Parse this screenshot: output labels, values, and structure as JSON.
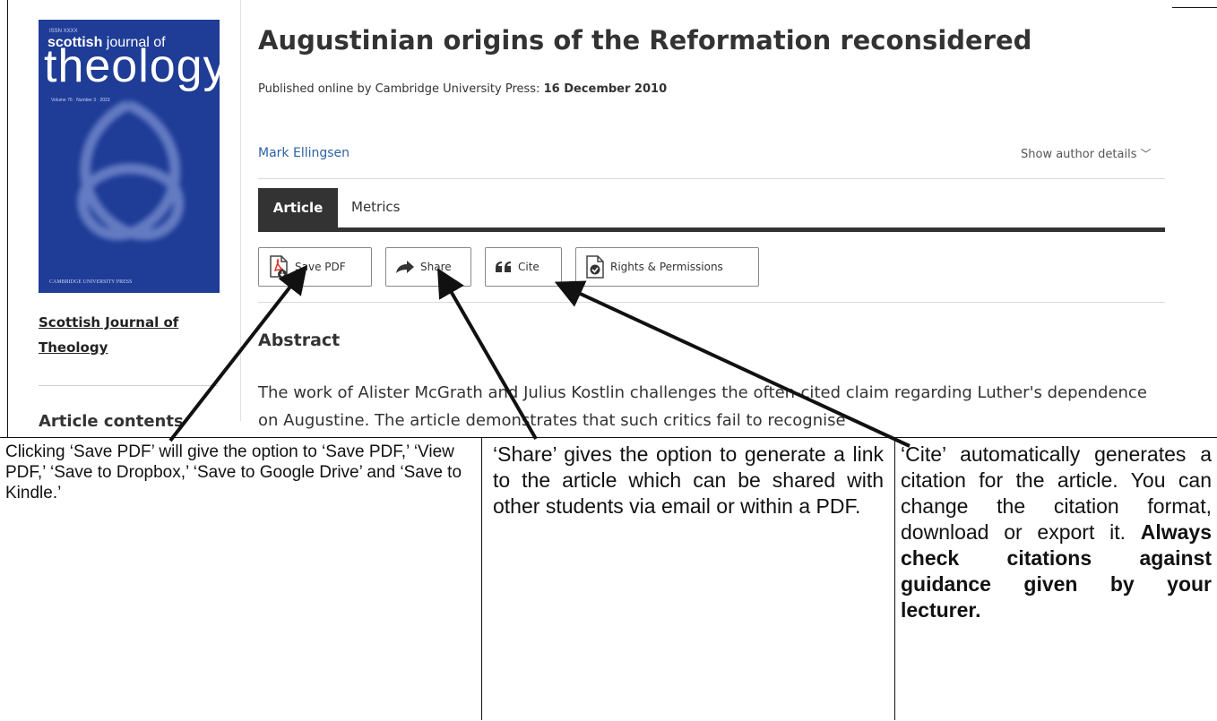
{
  "cover": {
    "issn_text": "ISSN XXXX",
    "journal_top": "scottish journal of",
    "journal_top_bold": "scottish",
    "journal_top_rest": " journal of",
    "journal_big": "theology",
    "volume_text": "Volume 76 · Number 3 · 2023",
    "publisher": "CAMBRIDGE UNIVERSITY PRESS"
  },
  "left": {
    "journal_link": "Scottish Journal of Theology",
    "contents_heading": "Article contents"
  },
  "article": {
    "title": "Augustinian origins of the Reformation reconsidered",
    "published_prefix": "Published online by Cambridge University Press: ",
    "published_date": "16 December 2010",
    "author": "Mark Ellingsen",
    "author_details_label": "Show author details"
  },
  "tabs": {
    "article": "Article",
    "metrics": "Metrics"
  },
  "actions": {
    "save_pdf": "Save PDF",
    "share": "Share",
    "cite": "Cite",
    "rights": "Rights & Permissions"
  },
  "abstract": {
    "heading": "Abstract",
    "text": "The work of Alister McGrath and Julius Kostlin challenges the often-cited claim regarding Luther's dependence on Augustine. The article demonstrates that such critics fail to recognise"
  },
  "annotations": {
    "save_pdf_note": "Clicking ‘Save PDF’ will give the option to ‘Save PDF,’ ‘View PDF,’ ‘Save to Dropbox,’ ‘Save to Google Drive’ and ‘Save to Kindle.’",
    "share_note": "‘Share’ gives the option to generate a link to the article which can be shared with other students via email or within a PDF.",
    "cite_note": "‘Cite’ automatically generates a citation for the article. You can change the citation format, download or export it.",
    "cite_note_bold": "Always check citations against guidance given by your lecturer."
  },
  "colors": {
    "cover_blue": "#1f3c97",
    "author_link": "#2d62a6",
    "tab_active": "#333333"
  }
}
